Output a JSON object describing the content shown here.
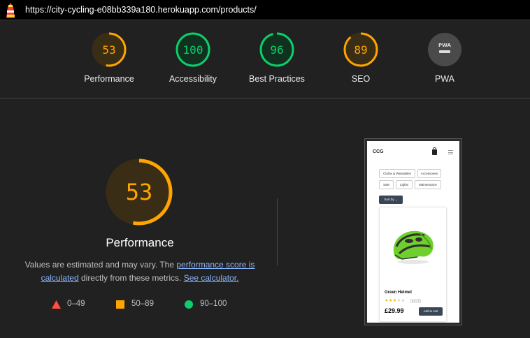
{
  "address_bar": {
    "url": "https://city-cycling-e08bb339a180.herokuapp.com/products/",
    "icon": "lighthouse-icon"
  },
  "categories": [
    {
      "id": "performance",
      "label": "Performance",
      "score": "53",
      "score_value": 53,
      "color": "#ffa400"
    },
    {
      "id": "accessibility",
      "label": "Accessibility",
      "score": "100",
      "score_value": 100,
      "color": "#0cce6b"
    },
    {
      "id": "best-practices",
      "label": "Best Practices",
      "score": "96",
      "score_value": 96,
      "color": "#0cce6b"
    },
    {
      "id": "seo",
      "label": "SEO",
      "score": "89",
      "score_value": 89,
      "color": "#ffa400"
    },
    {
      "id": "pwa",
      "label": "PWA",
      "badge": "PWA",
      "icon": "pwa-badge-icon"
    }
  ],
  "main": {
    "score": "53",
    "score_value": 53,
    "title": "Performance",
    "desc_pre": "Values are estimated and may vary. The ",
    "desc_link1": "performance score is calculated",
    "desc_mid": " directly from these metrics. ",
    "desc_link2": "See calculator."
  },
  "legend": [
    {
      "range": "0–49",
      "color": "#ff4e42",
      "icon": "triangle-icon"
    },
    {
      "range": "50–89",
      "color": "#ffa400",
      "icon": "square-icon"
    },
    {
      "range": "90–100",
      "color": "#0cce6b",
      "icon": "circle-icon"
    }
  ],
  "screenshot": {
    "brand": "CCG",
    "chips": [
      "Cloths & Wearables",
      "Accessories",
      "Sale",
      "Lights",
      "Maintenance"
    ],
    "sort_label": "Sort by",
    "product_name": "Green Helmet",
    "rating_stars": 3,
    "rating_max": 5,
    "rating_label": "3.0 / 5",
    "price": "£29.99",
    "add_label": "Add to cart"
  }
}
